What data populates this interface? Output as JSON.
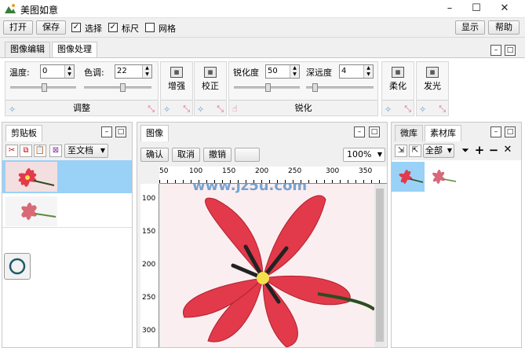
{
  "window": {
    "title": "美图如意",
    "minimize": "–",
    "maximize": "☐",
    "close": "✕"
  },
  "mainbar": {
    "open": "打开",
    "save": "保存",
    "select": {
      "label": "选择",
      "checked": "✓"
    },
    "ruler": {
      "label": "标尺",
      "checked": "✓"
    },
    "grid": {
      "label": "网格"
    },
    "display": "显示",
    "help": "帮助"
  },
  "tabs": {
    "edit": "图像编辑",
    "process": "图像处理"
  },
  "tools": {
    "adjust": {
      "temp_label": "温度:",
      "temp_value": "0",
      "hue_label": "色调:",
      "hue_value": "22",
      "title": "调整"
    },
    "enhance": "增强",
    "correct": "校正",
    "sharpen": {
      "sharp_label": "锐化度",
      "sharp_value": "50",
      "depth_label": "深远度",
      "depth_value": "4",
      "title": "锐化"
    },
    "soften": "柔化",
    "glow": "发光"
  },
  "clipboard": {
    "tab": "剪贴板",
    "to_doc": "至文档"
  },
  "image_panel": {
    "tab": "图像",
    "confirm": "确认",
    "cancel": "取消",
    "undo": "撤销",
    "zoom": "100%",
    "hticks": [
      "50",
      "100",
      "150",
      "200",
      "250",
      "300",
      "350"
    ],
    "vticks": [
      "100",
      "150",
      "200",
      "250",
      "300"
    ]
  },
  "library": {
    "micro_tab": "微库",
    "material_tab": "素材库",
    "filter": "全部"
  },
  "watermark": "www.jz5u.com",
  "colors": {
    "selected_row": "#99d1f7",
    "petal": "#e23a4a",
    "accent_blue": "#0a64b4"
  }
}
